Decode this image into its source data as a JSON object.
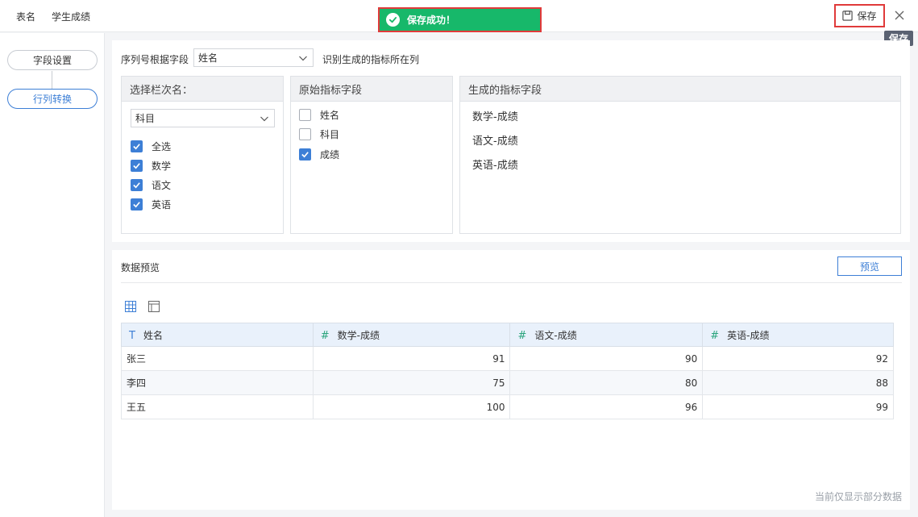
{
  "topbar": {
    "table_name_label": "表名",
    "table_name_value": "学生成绩",
    "toast_message": "保存成功！",
    "save_label": "保存",
    "tooltip": "保存"
  },
  "sidebar": {
    "steps": [
      {
        "label": "字段设置"
      },
      {
        "label": "行列转换"
      }
    ]
  },
  "config": {
    "sequence_label": "序列号根据字段",
    "sequence_value": "姓名",
    "sequence_suffix": "识别生成的指标所在列",
    "dimension_box": {
      "header": "选择栏次名：",
      "selected": "科目",
      "options": [
        {
          "label": "全选",
          "checked": true
        },
        {
          "label": "数学",
          "checked": true
        },
        {
          "label": "语文",
          "checked": true
        },
        {
          "label": "英语",
          "checked": true
        }
      ]
    },
    "source_box": {
      "header": "原始指标字段",
      "options": [
        {
          "label": "姓名",
          "checked": false
        },
        {
          "label": "科目",
          "checked": false
        },
        {
          "label": "成绩",
          "checked": true
        }
      ]
    },
    "generated_box": {
      "header": "生成的指标字段",
      "items": [
        "数学-成绩",
        "语文-成绩",
        "英语-成绩"
      ]
    }
  },
  "preview": {
    "title": "数据预览",
    "button": "预览",
    "columns": [
      {
        "type": "T",
        "name": "姓名"
      },
      {
        "type": "#",
        "name": "数学-成绩"
      },
      {
        "type": "#",
        "name": "语文-成绩"
      },
      {
        "type": "#",
        "name": "英语-成绩"
      }
    ],
    "rows": [
      [
        "张三",
        "91",
        "90",
        "92"
      ],
      [
        "李四",
        "75",
        "80",
        "88"
      ],
      [
        "王五",
        "100",
        "96",
        "99"
      ]
    ],
    "note": "当前仅显示部分数据"
  },
  "colors": {
    "accent": "#3d7fd6",
    "toast_bg": "#17b86a",
    "highlight_border": "#e03a3a"
  }
}
